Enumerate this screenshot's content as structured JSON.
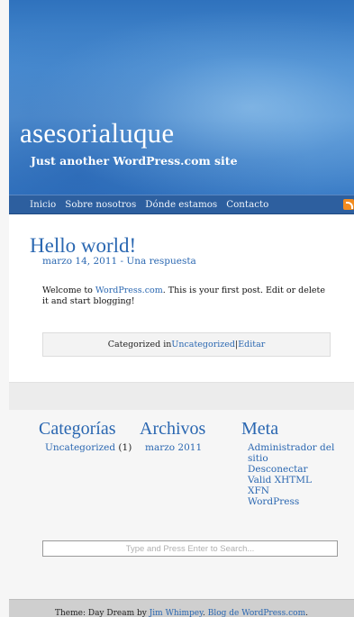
{
  "header": {
    "site_title": "asesorialuque",
    "site_description": "Just another WordPress.com site"
  },
  "nav": {
    "items": [
      {
        "label": "Inicio"
      },
      {
        "label": "Sobre nosotros"
      },
      {
        "label": "Dónde estamos"
      },
      {
        "label": "Contacto"
      }
    ],
    "rss_icon": "rss-icon",
    "rss_color": "#f28b1f"
  },
  "post": {
    "title": "Hello world!",
    "date": "marzo 14, 2011",
    "meta_separator": " - ",
    "comments_link": "Una respuesta",
    "body_prefix": "Welcome to ",
    "body_link": "WordPress.com",
    "body_suffix": ". This is your first post. Edit or delete it and start blogging!",
    "categorized_in": "Categorized in ",
    "category_link": "Uncategorized",
    "separator": " | ",
    "edit_link": "Editar"
  },
  "sidebar": {
    "categories": {
      "title": "Categorías",
      "items": [
        {
          "label": "Uncategorized",
          "count": " (1)"
        }
      ]
    },
    "archives": {
      "title": "Archivos",
      "items": [
        {
          "label": "marzo 2011"
        }
      ]
    },
    "meta": {
      "title": "Meta",
      "items": [
        {
          "label": "Administrador del sitio"
        },
        {
          "label": "Desconectar"
        },
        {
          "label": "Valid XHTML"
        },
        {
          "label": "XFN"
        },
        {
          "label": "WordPress"
        }
      ]
    }
  },
  "search": {
    "placeholder": "Type and Press Enter to Search..."
  },
  "footer": {
    "prefix": "Theme: Day Dream by ",
    "author_link": "Jim Whimpey",
    "middle": ". ",
    "blog_link": "Blog de WordPress.com",
    "suffix": "."
  },
  "colors": {
    "accent": "#2a67b1",
    "nav_bar": "#2d5f9f",
    "header_blue": "#4c8fd3"
  }
}
